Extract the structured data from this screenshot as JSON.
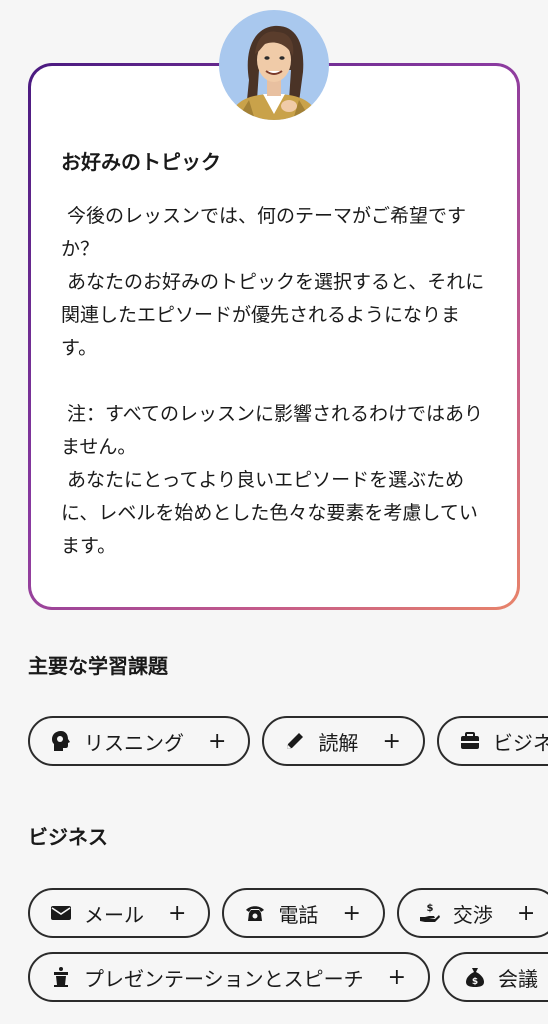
{
  "intro_card": {
    "title": "お好みのトピック",
    "paragraph_1": " 今後のレッスンでは、何のテーマがご希望ですか？\n あなたのお好みのトピックを選択すると、それに関連したエピソードが優先されるようになります。",
    "paragraph_2": " 注：すべてのレッスンに影響されるわけではありません。\n あなたにとってより良いエピソードを選ぶために、レベルを始めとした色々な要素を考慮しています。"
  },
  "avatar": {
    "icon": "tutor-avatar"
  },
  "sections": {
    "main": {
      "title": "主要な学習課題",
      "chips": [
        {
          "label": "リスニング",
          "icon": "head-listening-icon",
          "plus": "+"
        },
        {
          "label": "読解",
          "icon": "pencil-icon",
          "plus": "+"
        },
        {
          "label": "ビジネス",
          "icon": "briefcase-icon",
          "plus": "+"
        }
      ]
    },
    "business": {
      "title": "ビジネス",
      "chips_row_1": [
        {
          "label": "メール",
          "icon": "envelope-icon",
          "plus": "+"
        },
        {
          "label": "電話",
          "icon": "phone-icon",
          "plus": "+"
        },
        {
          "label": "交渉",
          "icon": "money-hand-icon",
          "plus": "+"
        }
      ],
      "chips_row_2": [
        {
          "label": "プレゼンテーションとスピーチ",
          "icon": "podium-icon",
          "plus": "+"
        },
        {
          "label": "会議",
          "icon": "money-bag-icon",
          "plus": "+"
        }
      ]
    }
  },
  "colors": {
    "background": "#f6f6f6",
    "card_border_start": "#4a1a80",
    "card_border_end": "#e8846a",
    "avatar_bg": "#a9c8ee",
    "chip_border": "#2b2b2b"
  }
}
